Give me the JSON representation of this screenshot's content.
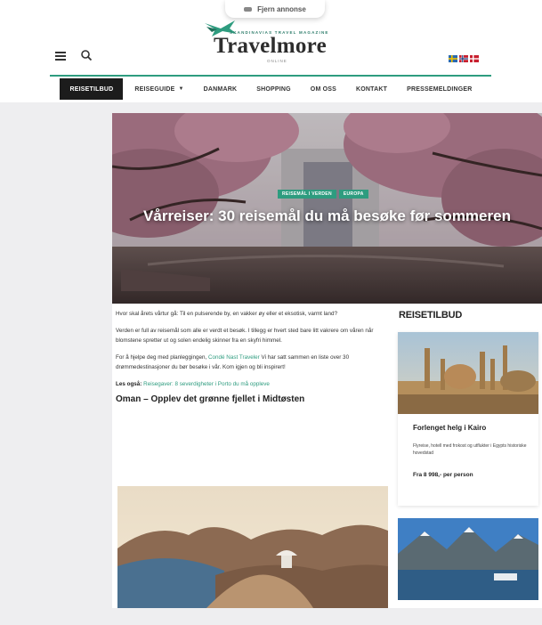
{
  "popup": {
    "label": "Fjern annonse"
  },
  "header": {
    "tagline": "SKANDINAVIAS TRAVEL MAGAZINE",
    "logo": "Travelmore",
    "logo_sub": "ONLINE",
    "icons": [
      "menu-icon",
      "search-icon"
    ],
    "flags": [
      "sweden-flag",
      "norway-flag",
      "denmark-flag"
    ]
  },
  "nav": {
    "items": [
      "Reisetilbud",
      "Reiseguide",
      "Danmark",
      "Shopping",
      "Om oss",
      "Kontakt",
      "Pressemeldinger"
    ]
  },
  "hero": {
    "tags": [
      "Reisemål i verden",
      "Europa"
    ],
    "title": "Vårreiser: 30 reisemål du må besøke før sommeren"
  },
  "article": {
    "p1": "Hvor skal årets vårtur gå: Til en pulserende by, en vakker øy eller et eksotisk, varmt land?",
    "p2": "Verden er full av reisemål som alle er verdt et besøk. I tillegg er hvert sted bare litt vakrere om våren når blomstene spretter ut og solen endelig skinner fra en skyfri himmel.",
    "p3_before": "For å hjelpe deg med planleggingen, ",
    "p3_link": "Condé Nast Traveler",
    "p3_after": " Vi har satt sammen en liste over 30 drømmedestinasjoner du bør besøke i vår. Kom igjen og bli inspirert!",
    "readmore_label": "Les også:",
    "readmore_link": "Reisegaver: 8 severdigheter i Porto du må oppleve",
    "h2": "Oman – Opplev det grønne fjellet i Midtøsten"
  },
  "sidebar": {
    "title": "REISETILBUD",
    "card": {
      "title": "Forlenget helg i Kairo",
      "desc": "Flyreise, hotell med frokost og utflukter i Egypts historiske hovedstad",
      "price": "Fra 8 998,- per person"
    }
  },
  "colors": {
    "accent": "#2e9c7f",
    "nav_active": "#1c1c1c",
    "background": "#eeeef0"
  }
}
